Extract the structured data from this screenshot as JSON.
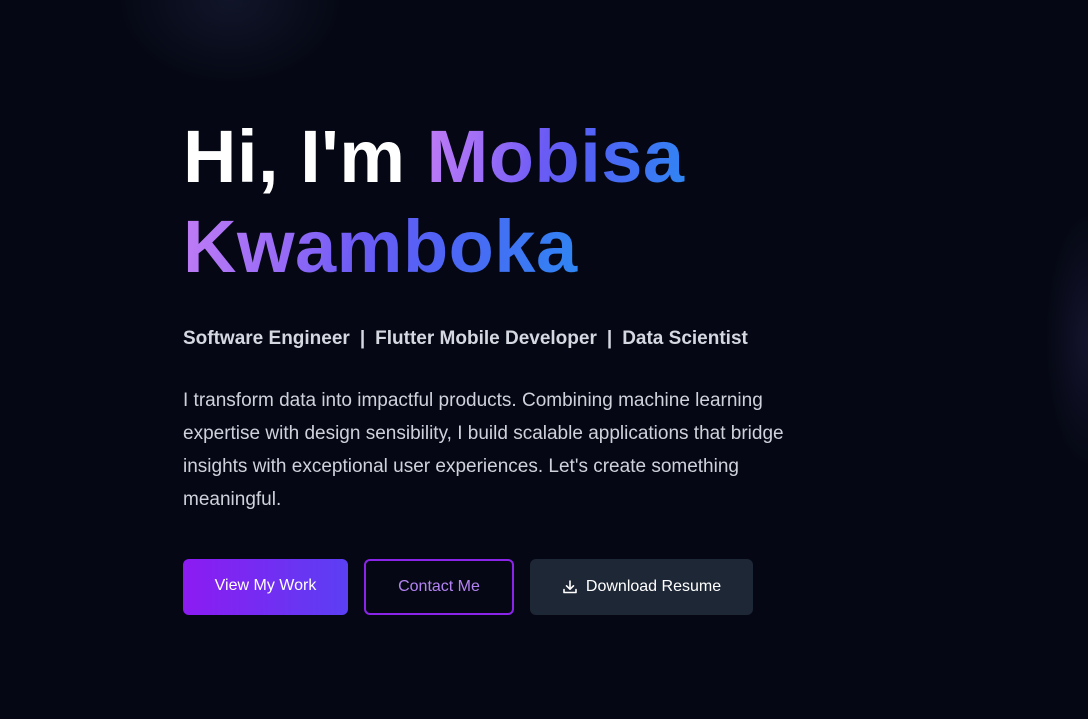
{
  "hero": {
    "greeting": "Hi, I'm",
    "name_first": "Mobisa",
    "name_last": "Kwamboka",
    "roles": [
      "Software Engineer",
      "Flutter Mobile Developer",
      "Data Scientist"
    ],
    "role_separator": "|",
    "bio": "I transform data into impactful products. Combining machine learning expertise with design sensibility, I build scalable applications that bridge insights with exceptional user experiences. Let's create something meaningful."
  },
  "actions": {
    "view_work": "View My Work",
    "contact": "Contact Me",
    "download_resume": "Download Resume",
    "download_icon": "download-icon"
  },
  "colors": {
    "background": "#050814",
    "primary_start": "#8c1bf2",
    "primary_end": "#5b3ff3",
    "outline": "#8a24e8",
    "dark_button": "#1e2736"
  }
}
